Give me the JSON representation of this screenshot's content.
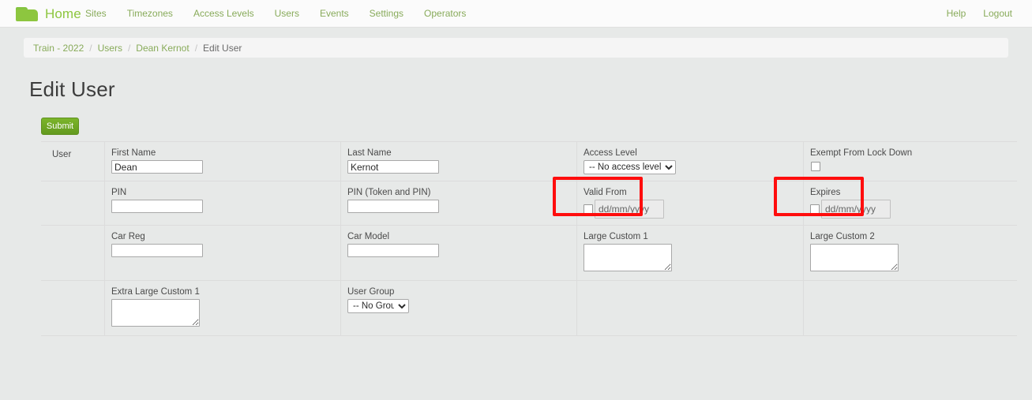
{
  "navbar": {
    "logo_icon": "folder-icon",
    "brand": "Home",
    "links": [
      {
        "label": "Sites"
      },
      {
        "label": "Timezones"
      },
      {
        "label": "Access Levels"
      },
      {
        "label": "Users"
      },
      {
        "label": "Events"
      },
      {
        "label": "Settings"
      },
      {
        "label": "Operators"
      }
    ],
    "right_links": [
      {
        "label": "Help"
      },
      {
        "label": "Logout"
      }
    ]
  },
  "breadcrumb": {
    "items": [
      {
        "label": "Train - 2022",
        "current": false
      },
      {
        "label": "Users",
        "current": false
      },
      {
        "label": "Dean Kernot",
        "current": false
      },
      {
        "label": "Edit User",
        "current": true
      }
    ],
    "separator": "/"
  },
  "page": {
    "title": "Edit User"
  },
  "toolbar": {
    "submit_label": "Submit"
  },
  "form": {
    "row_label": "User",
    "fields": {
      "first_name": {
        "label": "First Name",
        "value": "Dean"
      },
      "last_name": {
        "label": "Last Name",
        "value": "Kernot"
      },
      "access_level": {
        "label": "Access Level",
        "selected": "-- No access level --"
      },
      "exempt_lock_down": {
        "label": "Exempt From Lock Down",
        "checked": false
      },
      "pin": {
        "label": "PIN",
        "value": ""
      },
      "pin_token": {
        "label": "PIN (Token and PIN)",
        "value": ""
      },
      "valid_from": {
        "label": "Valid From",
        "checked": false,
        "placeholder": "dd/mm/yyyy"
      },
      "expires": {
        "label": "Expires",
        "checked": false,
        "placeholder": "dd/mm/yyyy"
      },
      "car_reg": {
        "label": "Car Reg",
        "value": ""
      },
      "car_model": {
        "label": "Car Model",
        "value": ""
      },
      "large_custom_1": {
        "label": "Large Custom 1",
        "value": ""
      },
      "large_custom_2": {
        "label": "Large Custom 2",
        "value": ""
      },
      "extra_large_custom_1": {
        "label": "Extra Large Custom 1",
        "value": ""
      },
      "user_group": {
        "label": "User Group",
        "selected": "-- No Group --"
      }
    }
  },
  "annotations": {
    "highlight_color": "#ff0d0d",
    "boxes": [
      {
        "target": "valid_from"
      },
      {
        "target": "expires"
      }
    ]
  },
  "colors": {
    "brand_green": "#8dc63f",
    "nav_link": "#88ab5a",
    "submit_green": "#6ba122",
    "page_bg": "#e7e9e8"
  }
}
